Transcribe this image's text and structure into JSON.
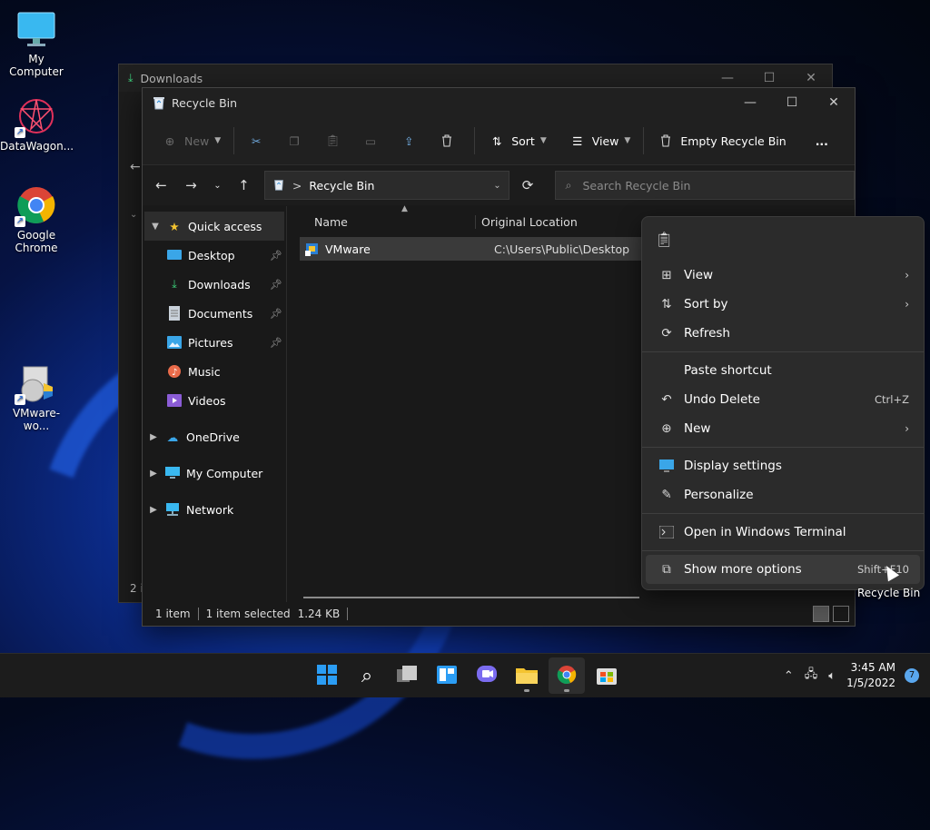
{
  "desktop": {
    "icons": [
      {
        "label": "My Computer"
      },
      {
        "label": "DataWagon..."
      },
      {
        "label": "Google Chrome"
      },
      {
        "label": "VMware-wo..."
      }
    ]
  },
  "back_window": {
    "title": "Downloads",
    "status_partial": "2 i"
  },
  "window": {
    "title": "Recycle Bin",
    "toolbar": {
      "new_label": "New",
      "sort_label": "Sort",
      "view_label": "View",
      "empty_label": "Empty Recycle Bin",
      "more_label": "..."
    },
    "address": {
      "separator": ">",
      "crumb": "Recycle Bin"
    },
    "search": {
      "placeholder": "Search Recycle Bin"
    },
    "nav": {
      "quick_access": "Quick access",
      "pinned": [
        {
          "label": "Desktop",
          "icon": "desktop-folder-icon",
          "pinned": true
        },
        {
          "label": "Downloads",
          "icon": "downloads-folder-icon",
          "pinned": true
        },
        {
          "label": "Documents",
          "icon": "documents-folder-icon",
          "pinned": true
        },
        {
          "label": "Pictures",
          "icon": "pictures-folder-icon",
          "pinned": true
        },
        {
          "label": "Music",
          "icon": "music-folder-icon",
          "pinned": false
        },
        {
          "label": "Videos",
          "icon": "videos-folder-icon",
          "pinned": false
        }
      ],
      "roots": [
        {
          "label": "OneDrive"
        },
        {
          "label": "My Computer"
        },
        {
          "label": "Network"
        }
      ]
    },
    "columns": {
      "name": "Name",
      "original_location": "Original Location"
    },
    "files": [
      {
        "name": "VMware",
        "location": "C:\\Users\\Public\\Desktop"
      }
    ],
    "status": {
      "count": "1 item",
      "selected": "1 item selected",
      "size": "1.24 KB"
    }
  },
  "context_menu": {
    "view": "View",
    "sort_by": "Sort by",
    "refresh": "Refresh",
    "paste_shortcut": "Paste shortcut",
    "undo_delete": "Undo Delete",
    "undo_shortcut": "Ctrl+Z",
    "new": "New",
    "display_settings": "Display settings",
    "personalize": "Personalize",
    "open_terminal": "Open in Windows Terminal",
    "show_more": "Show more options",
    "show_more_shortcut": "Shift+F10"
  },
  "tooltip": "Recycle Bin",
  "taskbar": {
    "time": "3:45 AM",
    "date": "1/5/2022",
    "notification_count": "7"
  },
  "colors": {
    "accent": "#0078d4",
    "folder_yellow": "#f4c430",
    "window_bg": "#191919",
    "menu_bg": "#2b2b2b"
  }
}
